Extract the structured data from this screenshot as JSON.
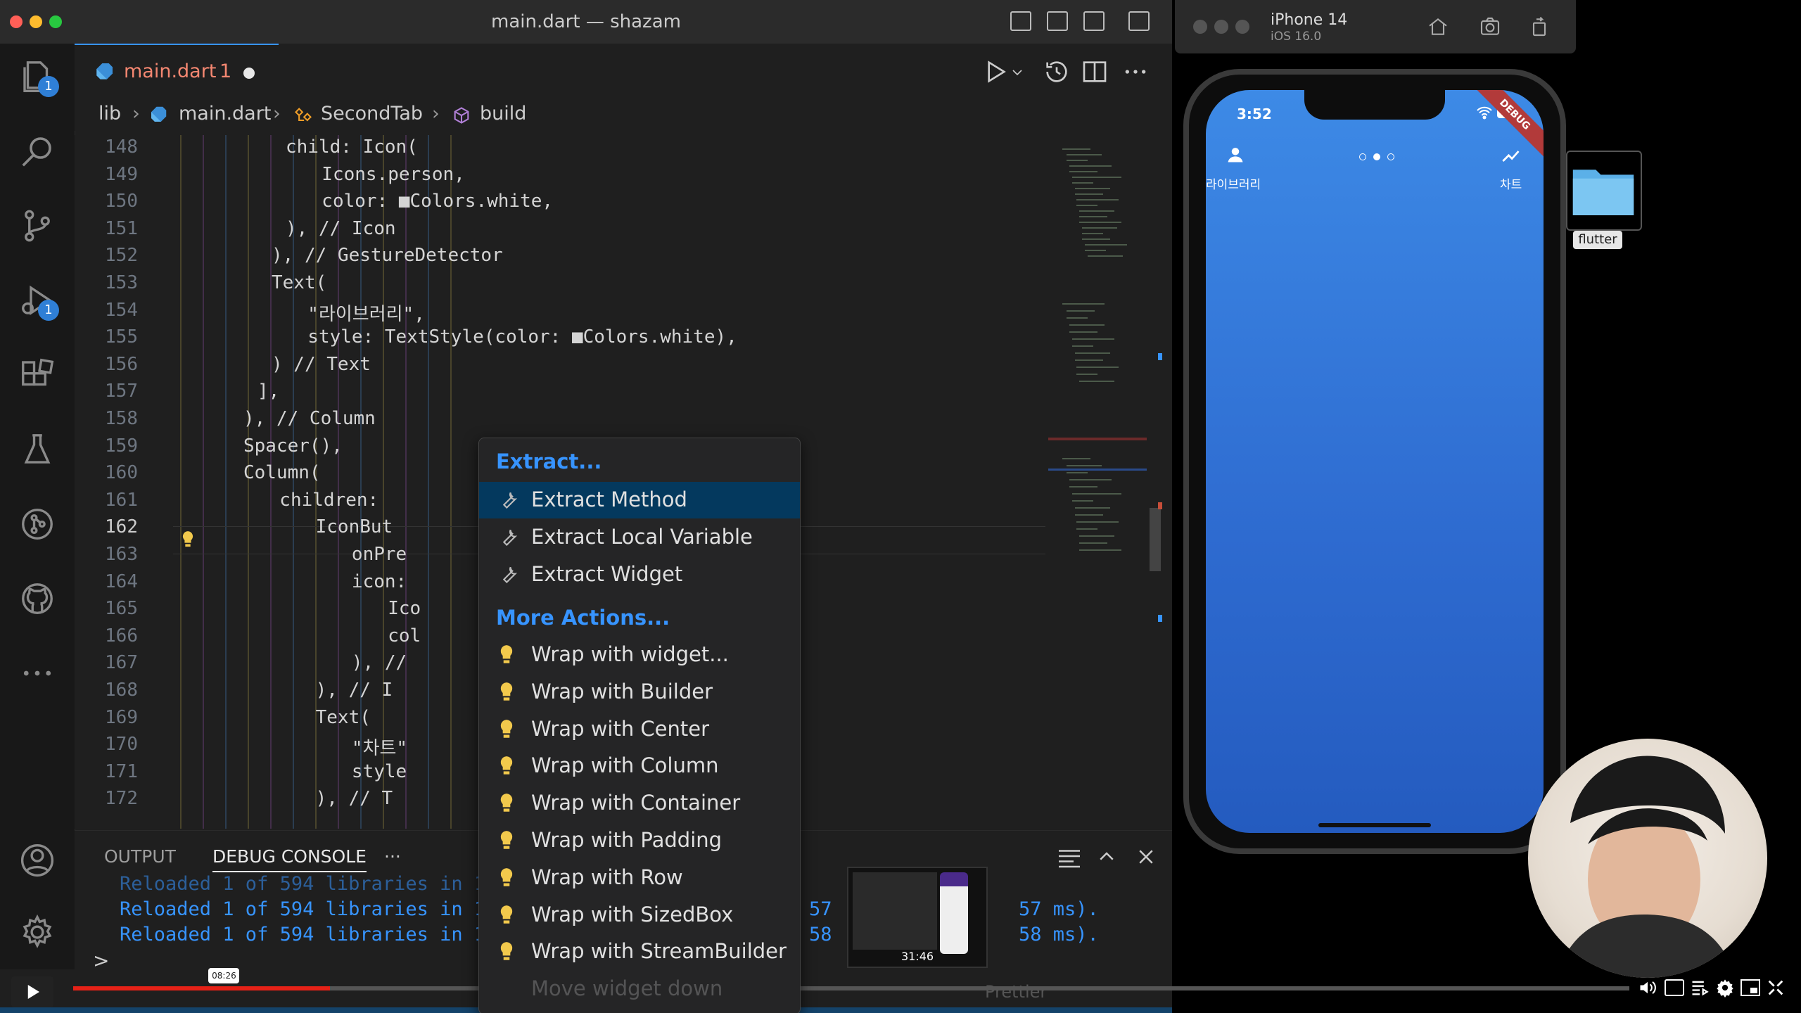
{
  "window": {
    "title": "main.dart — shazam"
  },
  "tab": {
    "filename": "main.dart",
    "problems": "1"
  },
  "activity_badges": {
    "explorer": "1",
    "run_debug": "1"
  },
  "breadcrumb": {
    "folder": "lib",
    "file": "main.dart",
    "class": "SecondTab",
    "method": "build"
  },
  "code_lines": [
    {
      "n": "148",
      "t": "child: Icon("
    },
    {
      "n": "149",
      "t": "  Icons.person,"
    },
    {
      "n": "150",
      "t": "  color: ■Colors.white,"
    },
    {
      "n": "151",
      "t": "), // Icon"
    },
    {
      "n": "152",
      "t": "), // GestureDetector"
    },
    {
      "n": "153",
      "t": "Text("
    },
    {
      "n": "154",
      "t": "  \"라이브러리\","
    },
    {
      "n": "155",
      "t": "  style: TextStyle(color: ■Colors.white),"
    },
    {
      "n": "156",
      "t": ") // Text"
    },
    {
      "n": "157",
      "t": "],"
    },
    {
      "n": "158",
      "t": "), // Column"
    },
    {
      "n": "159",
      "t": "Spacer(),"
    },
    {
      "n": "160",
      "t": "Column("
    },
    {
      "n": "161",
      "t": "  children:"
    },
    {
      "n": "162",
      "t": "    IconBut"
    },
    {
      "n": "163",
      "t": "      onPre"
    },
    {
      "n": "164",
      "t": "      icon:"
    },
    {
      "n": "165",
      "t": "        Ico"
    },
    {
      "n": "166",
      "t": "        col"
    },
    {
      "n": "167",
      "t": "      ), //"
    },
    {
      "n": "168",
      "t": "    ), // I"
    },
    {
      "n": "169",
      "t": "    Text("
    },
    {
      "n": "170",
      "t": "      \"차트\""
    },
    {
      "n": "171",
      "t": "      style                              hite),"
    },
    {
      "n": "172",
      "t": "    ), // T"
    }
  ],
  "context_menu": {
    "extract_header": "Extract...",
    "extract_items": [
      "Extract Method",
      "Extract Local Variable",
      "Extract Widget"
    ],
    "more_header": "More Actions...",
    "more_items": [
      "Wrap with widget...",
      "Wrap with Builder",
      "Wrap with Center",
      "Wrap with Column",
      "Wrap with Container",
      "Wrap with Padding",
      "Wrap with Row",
      "Wrap with SizedBox",
      "Wrap with StreamBuilder"
    ],
    "trailing": "Move widget down"
  },
  "panel": {
    "tabs": [
      "OUTPUT",
      "DEBUG CONSOLE"
    ],
    "more": "···",
    "lines": [
      "Reloaded 1 of 594 libraries in 1",
      "Reloaded 1 of 594 libraries in 1",
      "Reloaded 1 of 594 libraries in 1"
    ],
    "right_fragments": [
      "57 ms).",
      "58 ms)."
    ],
    "right_prefix": [
      "57",
      "58"
    ],
    "prompt": ">"
  },
  "simulator": {
    "device": "iPhone 14",
    "os": "iOS 16.0",
    "time": "3:52",
    "left_label": "라이브러리",
    "right_label": "차트",
    "debug_ribbon": "DEBUG"
  },
  "desktop": {
    "folder_label": "flutter"
  },
  "video": {
    "hover_time": "08:26",
    "thumb_time": "31:46",
    "progress": 0.165
  },
  "status_bar": {
    "prettier": "Prettier"
  },
  "colors": {
    "accent": "#3794ff",
    "error": "#f48771",
    "phone_bg": "#3d8ae6"
  }
}
